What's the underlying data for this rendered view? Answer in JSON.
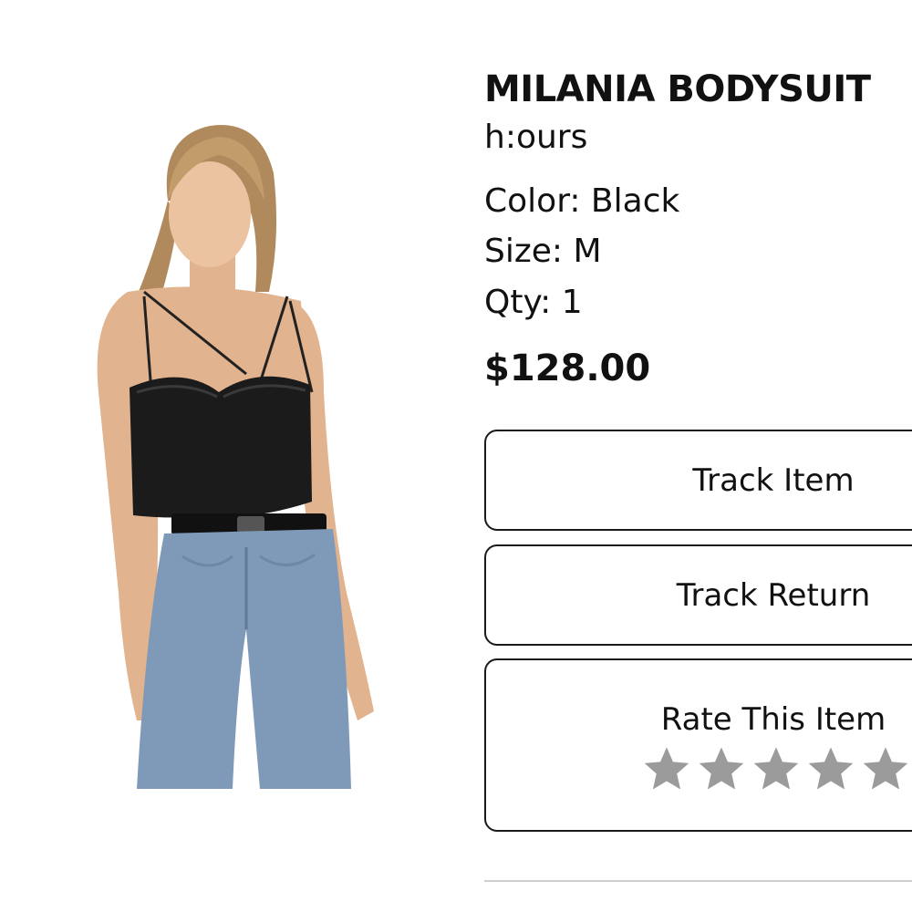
{
  "product": {
    "name": "MILANIA BODYSUIT",
    "brand": "h:ours",
    "color_label": "Color: Black",
    "size_label": "Size: M",
    "qty_label": "Qty: 1",
    "price": "$128.00",
    "image_icon": "product-photo-icon"
  },
  "actions": {
    "track_item": "Track Item",
    "track_return": "Track Return",
    "rate_item": "Rate This Item"
  },
  "rating": {
    "max": 5,
    "value": 0,
    "star_color": "#9b9b9b"
  },
  "colors": {
    "text": "#111111",
    "border": "#1a1a1a",
    "divider": "#cfcfcf"
  }
}
